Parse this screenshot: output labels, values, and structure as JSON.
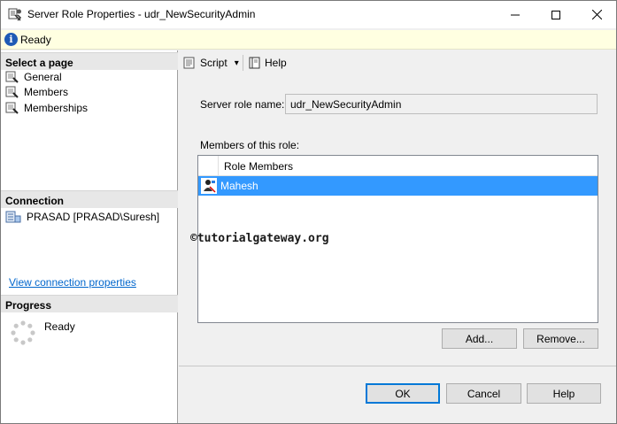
{
  "window": {
    "title": "Server Role Properties - udr_NewSecurityAdmin",
    "controls": {
      "minimize": "minimize",
      "maximize": "maximize",
      "close": "close"
    }
  },
  "status": {
    "icon": "info-icon",
    "text": "Ready"
  },
  "left_pane": {
    "select_page_header": "Select a page",
    "pages": [
      {
        "label": "General",
        "icon": "wrench-icon"
      },
      {
        "label": "Members",
        "icon": "wrench-icon"
      },
      {
        "label": "Memberships",
        "icon": "wrench-icon"
      }
    ],
    "connection_header": "Connection",
    "connection_text": "PRASAD [PRASAD\\Suresh]",
    "connection_link": "View connection properties",
    "progress_header": "Progress",
    "progress_text": "Ready"
  },
  "toolbar": {
    "script_label": "Script",
    "script_dropdown": "▾",
    "help_label": "Help"
  },
  "form": {
    "server_role_name_label": "Server role name:",
    "server_role_name_value": "udr_NewSecurityAdmin",
    "members_label": "Members of this role:",
    "grid_header": "Role Members",
    "members": [
      {
        "name": "Mahesh",
        "selected": true
      }
    ],
    "watermark": "©tutorialgateway.org"
  },
  "buttons": {
    "add": "Add...",
    "remove": "Remove...",
    "ok": "OK",
    "cancel": "Cancel",
    "help": "Help"
  },
  "colors": {
    "selection": "#3399ff",
    "link": "#0066cc",
    "status_bg": "#ffffe1"
  }
}
